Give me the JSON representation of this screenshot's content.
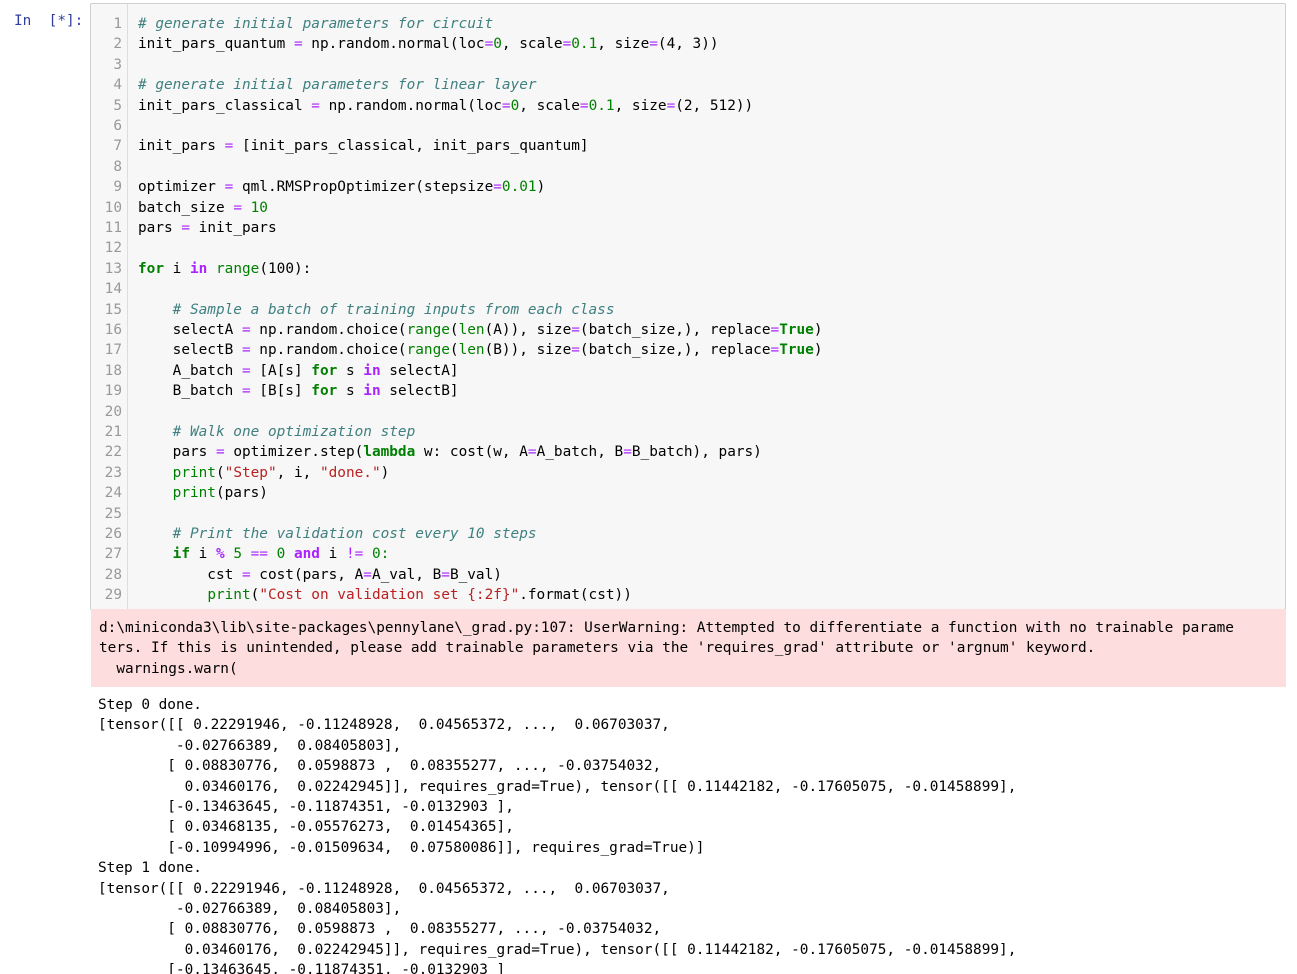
{
  "cell": {
    "prompt": "In  [*]:",
    "lines": [
      "1",
      "2",
      "3",
      "4",
      "5",
      "6",
      "7",
      "8",
      "9",
      "10",
      "11",
      "12",
      "13",
      "14",
      "15",
      "16",
      "17",
      "18",
      "19",
      "20",
      "21",
      "22",
      "23",
      "24",
      "25",
      "26",
      "27",
      "28",
      "29"
    ]
  },
  "code": {
    "l1": "# generate initial parameters for circuit",
    "l2a": "init_pars_quantum ",
    "l2b": " np.random.normal(loc",
    "l2c": "0",
    "l2d": ", scale",
    "l2e": "0.1",
    "l2f": ", size",
    "l2g": "(4, 3))",
    "l4": "# generate initial parameters for linear layer",
    "l5a": "init_pars_classical ",
    "l5b": " np.random.normal(loc",
    "l5c": "0",
    "l5d": ", scale",
    "l5e": "0.1",
    "l5f": ", size",
    "l5g": "(2, 512))",
    "l7a": "init_pars ",
    "l7b": " [init_pars_classical, init_pars_quantum]",
    "l9a": "optimizer ",
    "l9b": " qml.RMSPropOptimizer(stepsize",
    "l9c": "0.01",
    "l9d": ")",
    "l10a": "batch_size ",
    "l10b": " 10",
    "l11a": "pars ",
    "l11b": " init_pars",
    "l13a": "for",
    "l13b": " i ",
    "l13c": "in",
    "l13d": " ",
    "l13e": "range",
    "l13f": "(100):",
    "l15": "    # Sample a batch of training inputs from each class",
    "l16a": "    selectA ",
    "l16b": " np.random.choice(",
    "l16c": "range",
    "l16d": "(",
    "l16e": "len",
    "l16f": "(A)), size",
    "l16g": "(batch_size,), replace",
    "l16h": "True",
    "l16i": ")",
    "l17a": "    selectB ",
    "l17b": " np.random.choice(",
    "l17c": "range",
    "l17d": "(",
    "l17e": "len",
    "l17f": "(B)), size",
    "l17g": "(batch_size,), replace",
    "l17h": "True",
    "l17i": ")",
    "l18a": "    A_batch ",
    "l18b": " [A[s] ",
    "l18c": "for",
    "l18d": " s ",
    "l18e": "in",
    "l18f": " selectA]",
    "l19a": "    B_batch ",
    "l19b": " [B[s] ",
    "l19c": "for",
    "l19d": " s ",
    "l19e": "in",
    "l19f": " selectB]",
    "l21": "    # Walk one optimization step",
    "l22a": "    pars ",
    "l22b": " optimizer.step(",
    "l22c": "lambda",
    "l22d": " w: cost(w, A",
    "l22e": "A_batch, B",
    "l22f": "B_batch), pars)",
    "l23a": "    ",
    "l23b": "print",
    "l23c": "(",
    "l23d": "\"Step\"",
    "l23e": ", i, ",
    "l23f": "\"done.\"",
    "l23g": ")",
    "l24a": "    ",
    "l24b": "print",
    "l24c": "(pars)",
    "l26": "    # Print the validation cost every 10 steps",
    "l27a": "    ",
    "l27b": "if",
    "l27c": " i ",
    "l27d": "%",
    "l27e": " 5 ",
    "l27f": "==",
    "l27g": " 0 ",
    "l27h": "and",
    "l27i": " i ",
    "l27j": "!=",
    "l27k": " 0:",
    "l28a": "        cst ",
    "l28b": " cost(pars, A",
    "l28c": "A_val, B",
    "l28d": "B_val)",
    "l29a": "        ",
    "l29b": "print",
    "l29c": "(",
    "l29d": "\"Cost on validation set {:2f}\"",
    "l29e": ".format(cst))"
  },
  "stderr": "d:\\miniconda3\\lib\\site-packages\\pennylane\\_grad.py:107: UserWarning: Attempted to differentiate a function with no trainable parame\nters. If this is unintended, please add trainable parameters via the 'requires_grad' attribute or 'argnum' keyword.\n  warnings.warn(",
  "stdout": "Step 0 done.\n[tensor([[ 0.22291946, -0.11248928,  0.04565372, ...,  0.06703037,\n         -0.02766389,  0.08405803],\n        [ 0.08830776,  0.0598873 ,  0.08355277, ..., -0.03754032,\n          0.03460176,  0.02242945]], requires_grad=True), tensor([[ 0.11442182, -0.17605075, -0.01458899],\n        [-0.13463645, -0.11874351, -0.0132903 ],\n        [ 0.03468135, -0.05576273,  0.01454365],\n        [-0.10994996, -0.01509634,  0.07580086]], requires_grad=True)]\nStep 1 done.\n[tensor([[ 0.22291946, -0.11248928,  0.04565372, ...,  0.06703037,\n         -0.02766389,  0.08405803],\n        [ 0.08830776,  0.0598873 ,  0.08355277, ..., -0.03754032,\n          0.03460176,  0.02242945]], requires_grad=True), tensor([[ 0.11442182, -0.17605075, -0.01458899],\n        [-0.13463645, -0.11874351, -0.0132903 ]",
  "ops": {
    "eq": "="
  }
}
